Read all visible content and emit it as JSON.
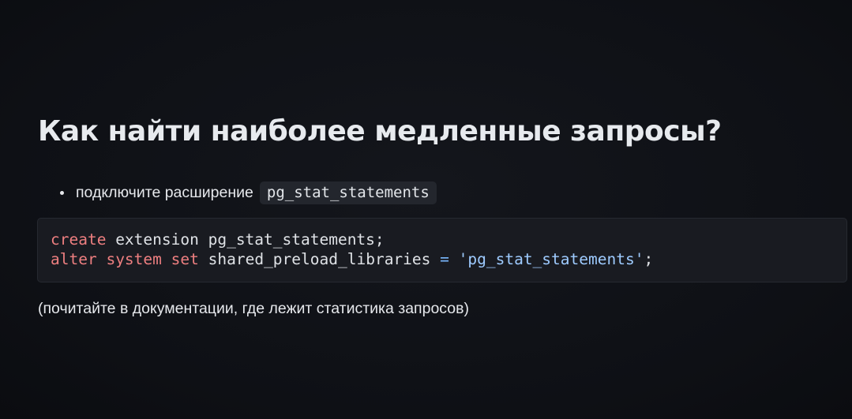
{
  "slide": {
    "title": "Как найти наиболее медленные запросы?",
    "bullet": {
      "text": "подключите расширение",
      "code": "pg_stat_statements"
    },
    "code_block": {
      "line1": {
        "kw": "create",
        "rest": " extension pg_stat_statements;"
      },
      "line2": {
        "kw1": "alter",
        "sp1": " ",
        "kw2": "system",
        "sp2": " ",
        "kw3": "set",
        "mid": " shared_preload_libraries ",
        "op": "=",
        "sp3": " ",
        "str": "'pg_stat_statements'",
        "end": ";"
      }
    },
    "note": "(почитайте в документации, где лежит статистика запросов)"
  },
  "colors": {
    "background": "#0f1116",
    "text": "#e6e8ec",
    "keyword": "#ee7f80",
    "operator": "#79b8ff",
    "string": "#9ecbff",
    "code_bg": "#191b21",
    "inline_code_bg": "#23262d"
  }
}
